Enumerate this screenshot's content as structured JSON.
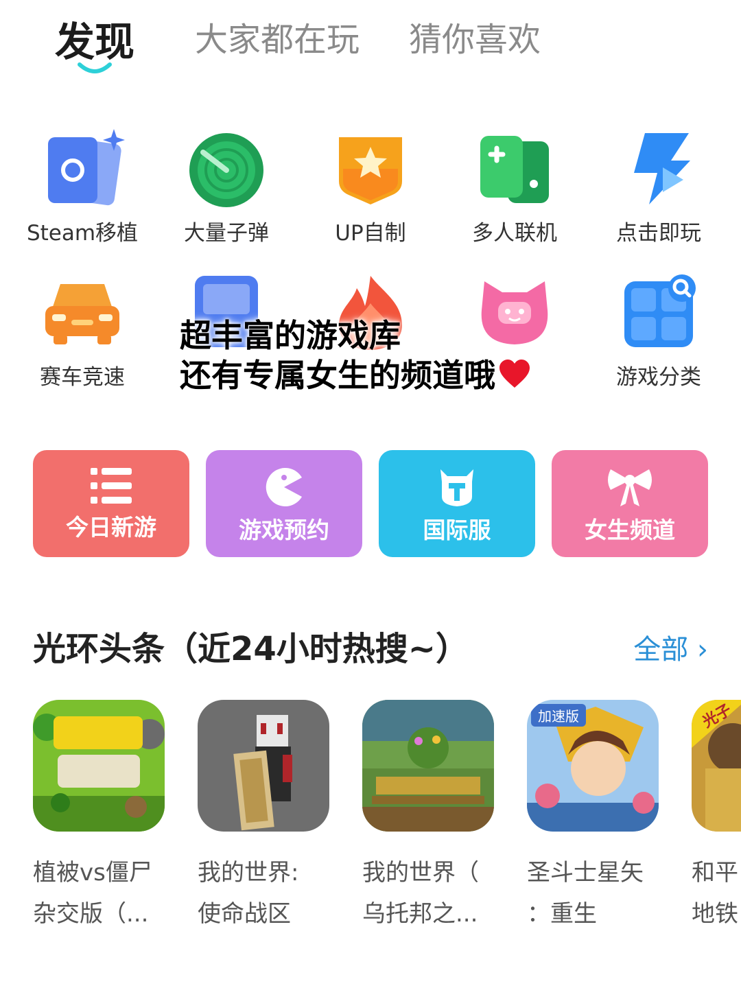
{
  "tabs": [
    {
      "label": "发现",
      "active": true
    },
    {
      "label": "大家都在玩",
      "active": false
    },
    {
      "label": "猜你喜欢",
      "active": false
    }
  ],
  "icon_grid": [
    {
      "label": "Steam移植",
      "icon": "steam-cards-icon",
      "color": "#4f7cf0"
    },
    {
      "label": "大量子弹",
      "icon": "radar-icon",
      "color": "#21a55c"
    },
    {
      "label": "UP自制",
      "icon": "star-badge-icon",
      "color": "#f6a21c"
    },
    {
      "label": "多人联机",
      "icon": "gamepad-icon",
      "color": "#2fbd5c"
    },
    {
      "label": "点击即玩",
      "icon": "lightning-play-icon",
      "color": "#2f8cf5"
    },
    {
      "label": "赛车竞速",
      "icon": "car-icon",
      "color": "#f58a2a"
    },
    {
      "label": "",
      "icon": "console-icon",
      "color": "#4f7cf0"
    },
    {
      "label": "",
      "icon": "flame-icon",
      "color": "#f2553c"
    },
    {
      "label": "",
      "icon": "cat-face-icon",
      "color": "#f46aa5"
    },
    {
      "label": "游戏分类",
      "icon": "category-grid-icon",
      "color": "#2f8cf5"
    }
  ],
  "caption": {
    "line1": "超丰富的游戏库",
    "line2": "还有专属女生的频道哦"
  },
  "big_buttons": [
    {
      "label": "今日新游",
      "icon": "list-icon",
      "color": "#f26f6c"
    },
    {
      "label": "游戏预约",
      "icon": "pacman-icon",
      "color": "#c583ea"
    },
    {
      "label": "国际服",
      "icon": "helmet-icon",
      "color": "#2cc0ea"
    },
    {
      "label": "女生频道",
      "icon": "bow-icon",
      "color": "#f27ba6"
    }
  ],
  "section": {
    "title": "光环头条（近24小时热搜~）",
    "more_label": "全部",
    "more_chevron": "›"
  },
  "games": [
    {
      "line1": "植被vs僵尸",
      "line2": "杂交版（..."
    },
    {
      "line1": "我的世界:",
      "line2": " 使命战区"
    },
    {
      "line1": "我的世界（",
      "line2": "乌托邦之..."
    },
    {
      "line1": "圣斗士星矢",
      "line2": "：重生",
      "badge": "加速版"
    },
    {
      "line1": "和平",
      "line2": "地铁",
      "badge": "光子"
    }
  ]
}
